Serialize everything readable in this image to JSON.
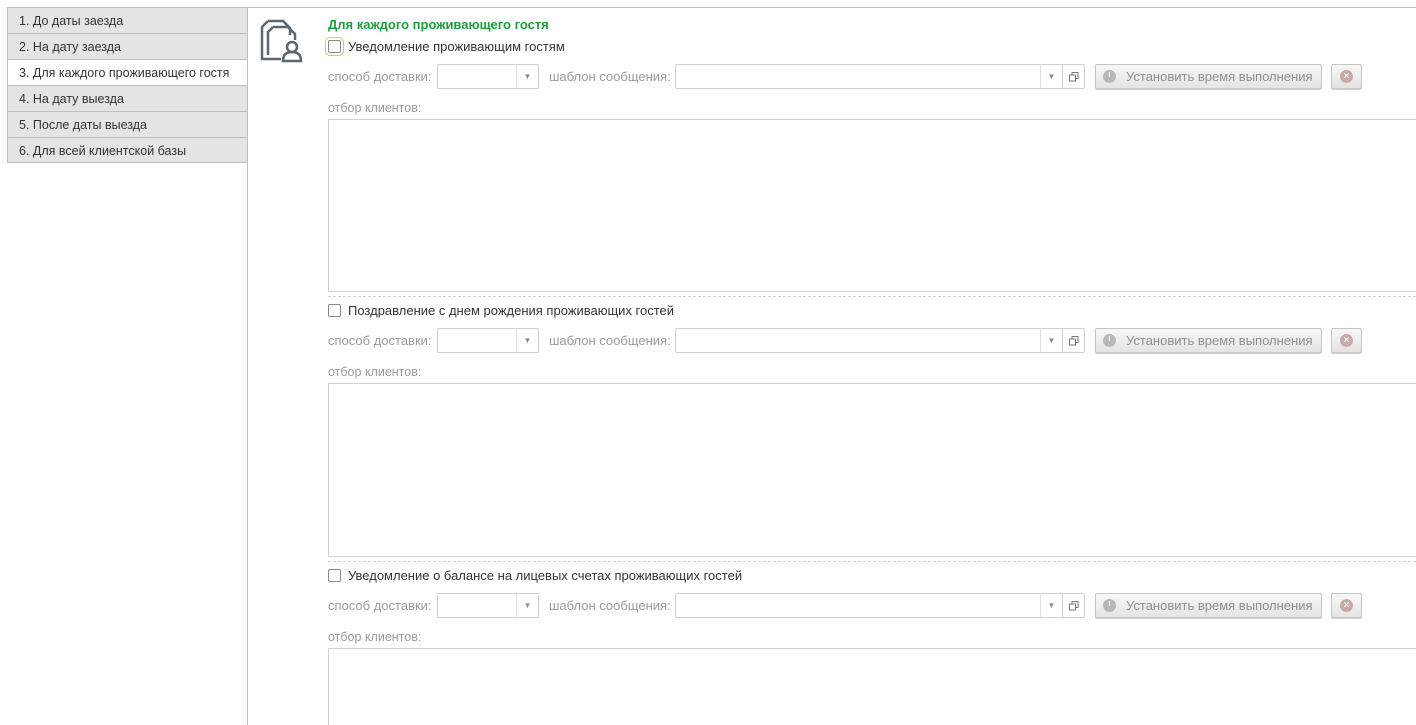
{
  "tabs": [
    {
      "label": "1. До даты заезда"
    },
    {
      "label": "2. На дату заезда"
    },
    {
      "label": "3. Для каждого проживающего гостя"
    },
    {
      "label": "4. На дату выезда"
    },
    {
      "label": "5. После даты выезда"
    },
    {
      "label": "6. Для всей клиентской базы"
    }
  ],
  "active_tab": 2,
  "section": {
    "title": "Для каждого проживающего гостя",
    "icon": "document-person-icon"
  },
  "labels": {
    "delivery": "способ доставки:",
    "template": "шаблон сообщения:",
    "set_time": "Установить время выполнения",
    "filter": "отбор клиентов:"
  },
  "blocks": [
    {
      "checkbox_label": "Уведомление проживающим гостям",
      "checked": false,
      "delivery_value": "",
      "template_value": ""
    },
    {
      "checkbox_label": "Поздравление с днем рождения проживающих гостей",
      "checked": false,
      "delivery_value": "",
      "template_value": ""
    },
    {
      "checkbox_label": "Уведомление о балансе на лицевых счетах проживающих гостей",
      "checked": false,
      "delivery_value": "",
      "template_value": ""
    }
  ],
  "colors": {
    "title_green": "#1a9f3a",
    "tab_bg": "#e4e4e4",
    "border": "#bdbdbd",
    "focus_outline": "#e8c04a"
  }
}
